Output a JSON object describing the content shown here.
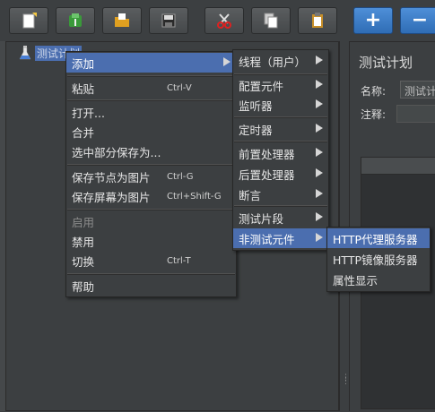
{
  "toolbar": {
    "buttons": [
      {
        "name": "new-plan-button",
        "icon": "new-document-icon"
      },
      {
        "name": "templates-button",
        "icon": "templates-icon"
      },
      {
        "name": "open-button",
        "icon": "folder-open-icon"
      },
      {
        "name": "save-button",
        "icon": "floppy-disk-icon"
      },
      {
        "name": "cut-button",
        "icon": "scissors-icon"
      },
      {
        "name": "copy-button",
        "icon": "copy-icon"
      },
      {
        "name": "paste-button",
        "icon": "clipboard-icon"
      },
      {
        "name": "expand-button",
        "icon": "plus-icon",
        "label": "+"
      },
      {
        "name": "collapse-button",
        "icon": "minus-icon",
        "label": "−"
      }
    ]
  },
  "tree": {
    "root": {
      "icon": "test-tube-icon",
      "label": "测试计划"
    }
  },
  "right_panel": {
    "title": "测试计划",
    "name_label": "名称:",
    "name_value": "测试计划",
    "comment_label": "注释:"
  },
  "context_menu": {
    "items": [
      {
        "label": "添加",
        "shortcut": "",
        "submenu": true,
        "selected": true
      },
      {
        "label": "粘贴",
        "shortcut": "Ctrl-V"
      },
      {
        "label": "打开...",
        "shortcut": ""
      },
      {
        "label": "合并",
        "shortcut": ""
      },
      {
        "label": "选中部分保存为...",
        "shortcut": ""
      },
      {
        "label": "保存节点为图片",
        "shortcut": "Ctrl-G"
      },
      {
        "label": "保存屏幕为图片",
        "shortcut": "Ctrl+Shift-G"
      },
      {
        "label": "启用",
        "shortcut": "",
        "disabled": true
      },
      {
        "label": "禁用",
        "shortcut": ""
      },
      {
        "label": "切换",
        "shortcut": "Ctrl-T"
      },
      {
        "label": "帮助",
        "shortcut": ""
      }
    ]
  },
  "add_submenu": {
    "items": [
      {
        "label": "线程（用户）"
      },
      {
        "label": "配置元件"
      },
      {
        "label": "监听器"
      },
      {
        "label": "定时器"
      },
      {
        "label": "前置处理器"
      },
      {
        "label": "后置处理器"
      },
      {
        "label": "断言"
      },
      {
        "label": "测试片段"
      },
      {
        "label": "非测试元件",
        "selected": true
      }
    ]
  },
  "non_test_submenu": {
    "items": [
      {
        "label": "HTTP代理服务器",
        "selected": true
      },
      {
        "label": "HTTP镜像服务器"
      },
      {
        "label": "属性显示"
      }
    ]
  },
  "colors": {
    "background": "#3c3f41",
    "selection": "#4b6eaf",
    "text": "#dcdcdc"
  }
}
